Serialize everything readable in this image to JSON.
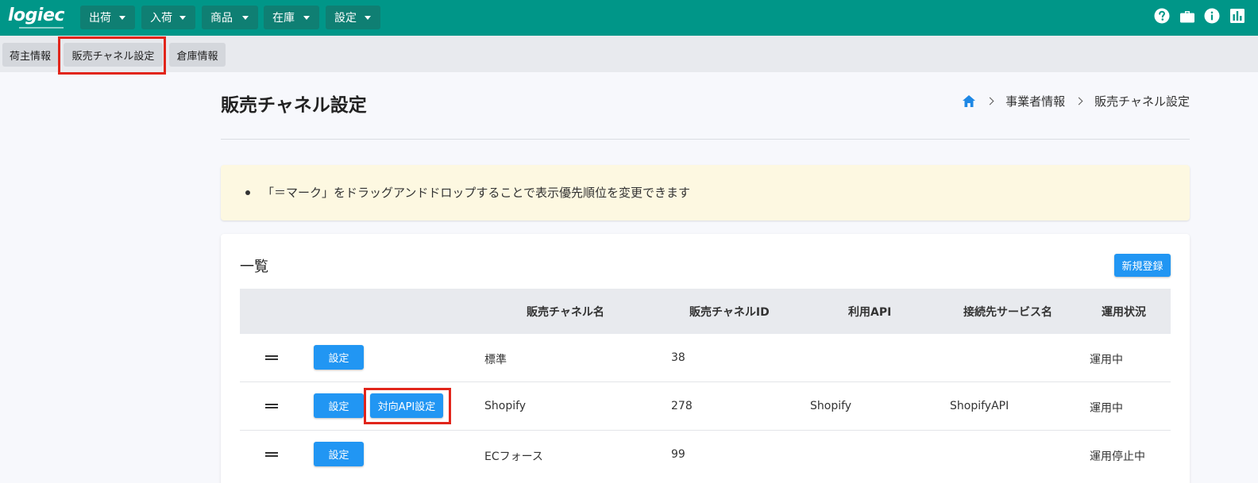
{
  "app": {
    "logo_text": "logiec"
  },
  "nav": {
    "menus": [
      {
        "label": "出荷"
      },
      {
        "label": "入荷"
      },
      {
        "label": "商品"
      },
      {
        "label": "在庫"
      },
      {
        "label": "設定"
      }
    ],
    "icons": [
      "help-icon",
      "briefcase-icon",
      "info-icon",
      "bar-chart-icon"
    ]
  },
  "subtabs": [
    {
      "label": "荷主情報"
    },
    {
      "label": "販売チャネル設定",
      "highlighted": true
    },
    {
      "label": "倉庫情報"
    }
  ],
  "page": {
    "title": "販売チャネル設定",
    "breadcrumb": [
      "事業者情報",
      "販売チャネル設定"
    ]
  },
  "notice": {
    "text": "「＝マーク」をドラッグアンドドロップすることで表示優先順位を変更できます"
  },
  "list": {
    "title": "一覧",
    "new_button": "新規登録",
    "columns": [
      "販売チャネル名",
      "販売チャネルID",
      "利用API",
      "接続先サービス名",
      "運用状況"
    ],
    "rows": [
      {
        "setting_button": "設定",
        "api_button": "",
        "name": "標準",
        "id": "38",
        "api": "",
        "service": "",
        "status": "運用中"
      },
      {
        "setting_button": "設定",
        "api_button": "対向API設定",
        "name": "Shopify",
        "id": "278",
        "api": "Shopify",
        "service": "ShopifyAPI",
        "status": "運用中"
      },
      {
        "setting_button": "設定",
        "api_button": "",
        "name": "ECフォース",
        "id": "99",
        "api": "",
        "service": "",
        "status": "運用停止中"
      }
    ]
  },
  "colors": {
    "topbar": "#009688",
    "menu_button": "#0f7f73",
    "primary_button": "#2196f3",
    "highlight_box": "#e1251b",
    "notice_bg": "#fdf8e1"
  }
}
